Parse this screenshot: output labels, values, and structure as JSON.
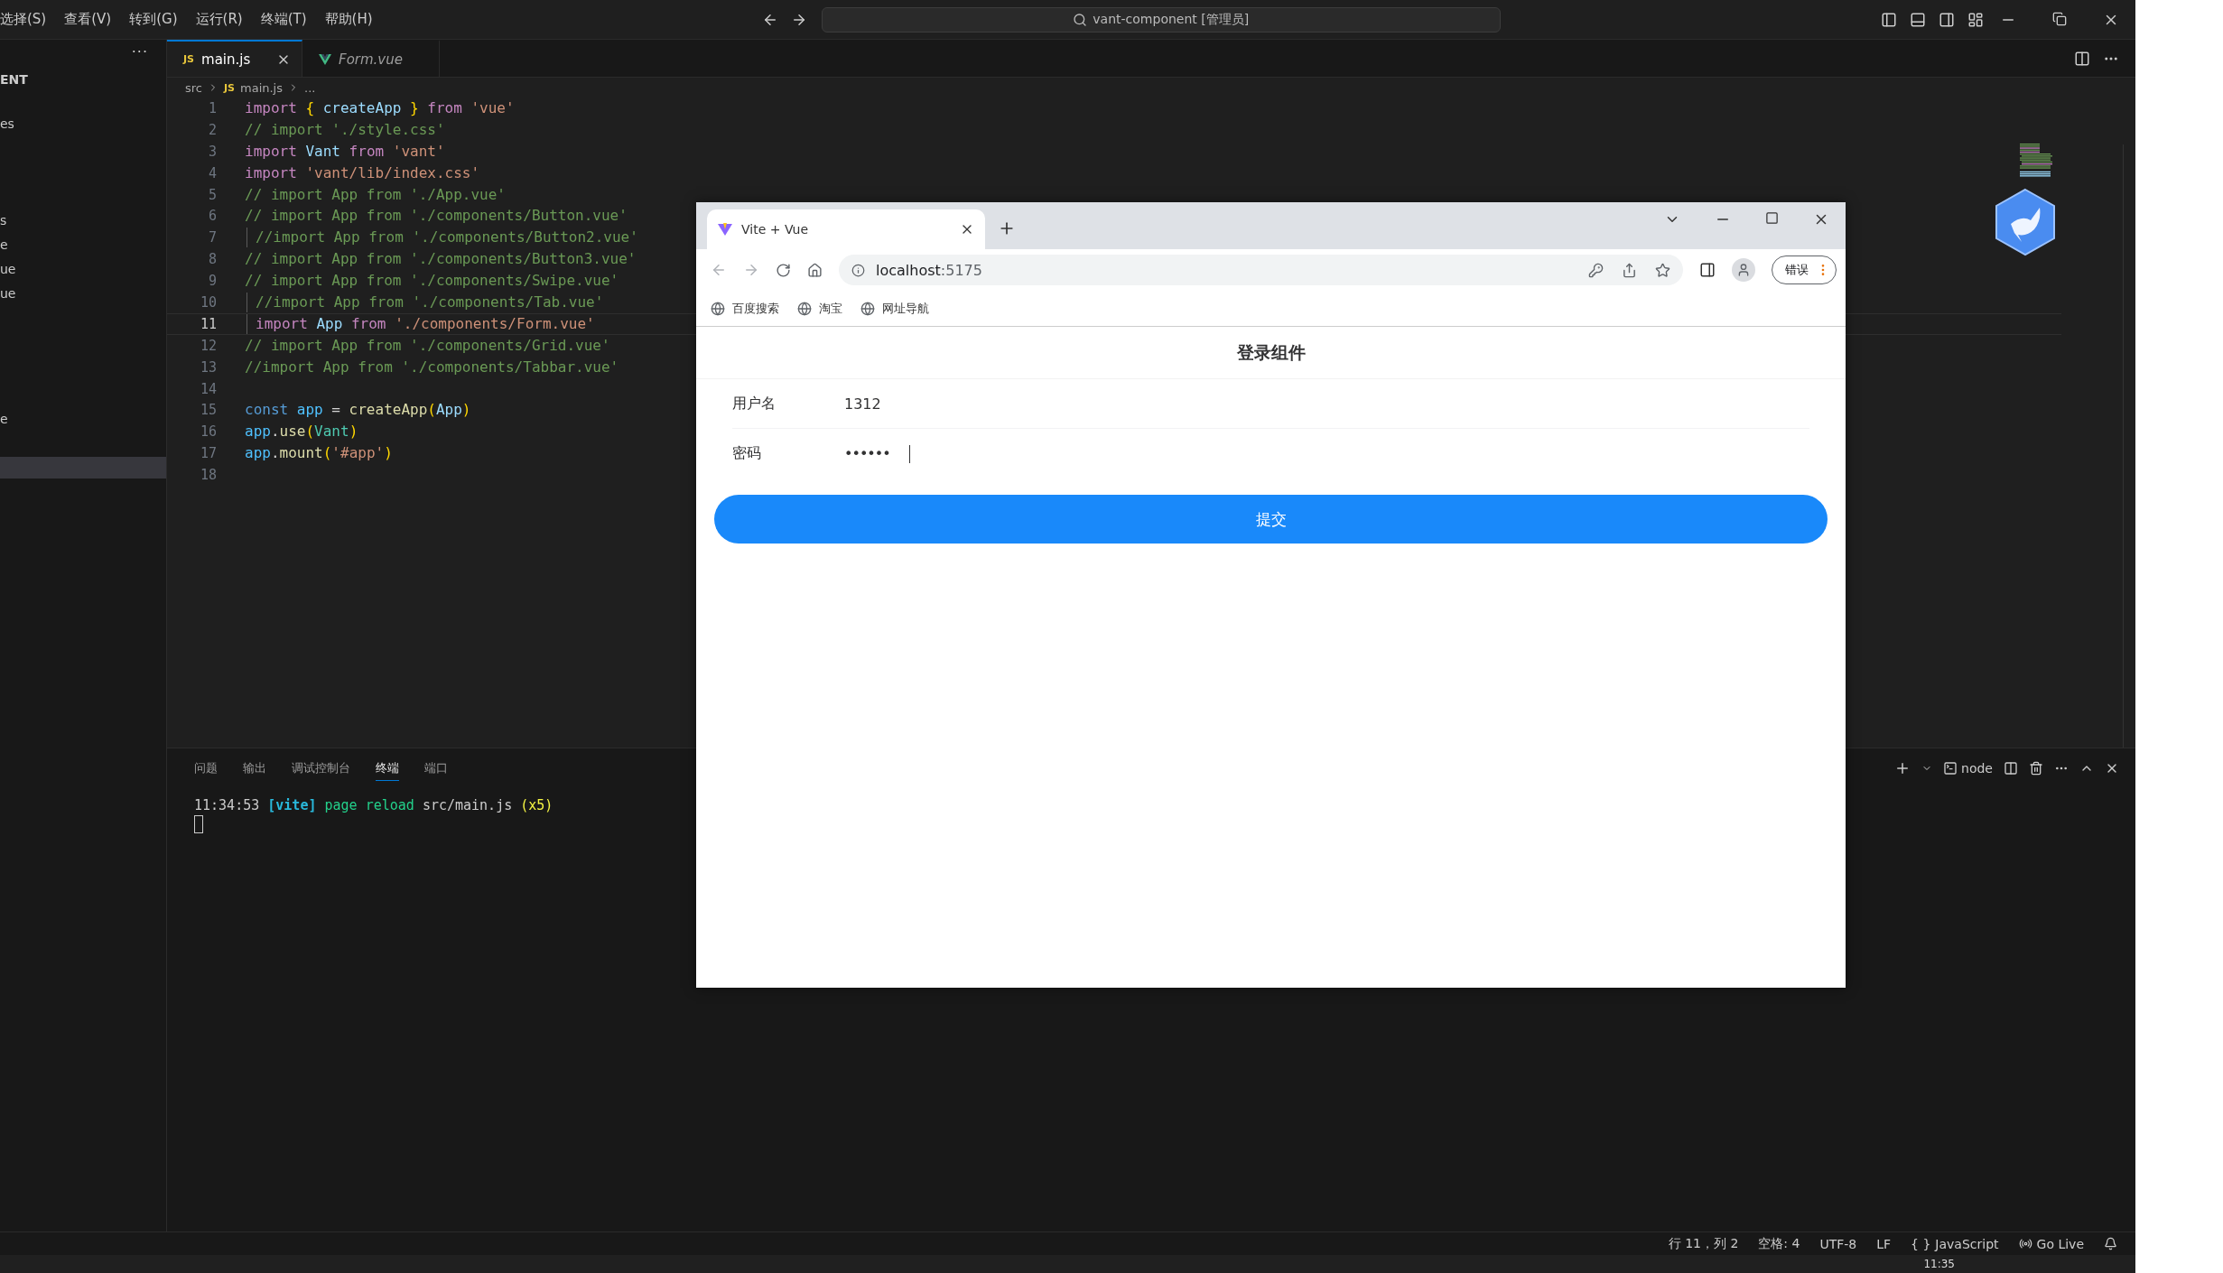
{
  "menu": [
    "选择(S)",
    "查看(V)",
    "转到(G)",
    "运行(R)",
    "终端(T)",
    "帮助(H)"
  ],
  "command_center": "vant-component [管理员]",
  "sidebar": {
    "more": "···",
    "items": [
      {
        "label": "ENT",
        "selected": false,
        "kind": "header"
      },
      {
        "label": "es",
        "selected": false,
        "kind": "item"
      },
      {
        "label": "s",
        "selected": false,
        "kind": "item"
      },
      {
        "label": "e",
        "selected": false,
        "kind": "item"
      },
      {
        "label": "ue",
        "selected": false,
        "kind": "item"
      },
      {
        "label": "ue",
        "selected": false,
        "kind": "item"
      },
      {
        "label": "e",
        "selected": false,
        "kind": "item"
      },
      {
        "selected": true,
        "kind": "spacer"
      }
    ]
  },
  "editor_tabs": [
    {
      "label": "main.js",
      "kind": "js",
      "icon_text": "JS",
      "selected": true,
      "preview": false
    },
    {
      "label": "Form.vue",
      "kind": "vue",
      "selected": false,
      "preview": true
    }
  ],
  "breadcrumb": {
    "folder": "src",
    "icon_text": "JS",
    "file": "main.js",
    "rest": "..."
  },
  "code": [
    {
      "number": "1",
      "current": false,
      "guide": false,
      "tokens": [
        {
          "text": "import ",
          "kind": "keyword"
        },
        {
          "text": "{ ",
          "kind": "brace"
        },
        {
          "text": "createApp ",
          "kind": "ident"
        },
        {
          "text": "} ",
          "kind": "brace"
        },
        {
          "text": "from ",
          "kind": "keyword"
        },
        {
          "text": "'vue'",
          "kind": "string"
        }
      ]
    },
    {
      "number": "2",
      "current": false,
      "guide": false,
      "tokens": [
        {
          "text": "// import './style.css'",
          "kind": "comment"
        }
      ]
    },
    {
      "number": "3",
      "current": false,
      "guide": false,
      "tokens": [
        {
          "text": "import ",
          "kind": "keyword"
        },
        {
          "text": "Vant ",
          "kind": "ident"
        },
        {
          "text": "from ",
          "kind": "keyword"
        },
        {
          "text": "'vant'",
          "kind": "string"
        }
      ]
    },
    {
      "number": "4",
      "current": false,
      "guide": false,
      "tokens": [
        {
          "text": "import ",
          "kind": "keyword"
        },
        {
          "text": "'vant/lib/index.css'",
          "kind": "string"
        }
      ]
    },
    {
      "number": "5",
      "current": false,
      "guide": false,
      "tokens": [
        {
          "text": "// import App from './App.vue'",
          "kind": "comment"
        }
      ]
    },
    {
      "number": "6",
      "current": false,
      "guide": false,
      "tokens": [
        {
          "text": "// import App from './components/Button.vue'",
          "kind": "comment"
        }
      ]
    },
    {
      "number": "7",
      "current": false,
      "guide": true,
      "tokens": [
        {
          "text": "//import App from './components/Button2.vue'",
          "kind": "comment"
        }
      ]
    },
    {
      "number": "8",
      "current": false,
      "guide": false,
      "tokens": [
        {
          "text": "// import App from './components/Button3.vue'",
          "kind": "comment"
        }
      ]
    },
    {
      "number": "9",
      "current": false,
      "guide": false,
      "tokens": [
        {
          "text": "// import App from './components/Swipe.vue'",
          "kind": "comment"
        }
      ]
    },
    {
      "number": "10",
      "current": false,
      "guide": true,
      "tokens": [
        {
          "text": "//import App from './components/Tab.vue'",
          "kind": "comment"
        }
      ]
    },
    {
      "number": "11",
      "current": true,
      "guide": true,
      "tokens": [
        {
          "text": "import ",
          "kind": "keyword"
        },
        {
          "text": "App ",
          "kind": "ident"
        },
        {
          "text": "from ",
          "kind": "keyword"
        },
        {
          "text": "'./components/Form.vue'",
          "kind": "string"
        }
      ]
    },
    {
      "number": "12",
      "current": false,
      "guide": false,
      "tokens": [
        {
          "text": "// import App from './components/Grid.vue'",
          "kind": "comment"
        }
      ]
    },
    {
      "number": "13",
      "current": false,
      "guide": false,
      "tokens": [
        {
          "text": "//import App from './components/Tabbar.vue'",
          "kind": "comment"
        }
      ]
    },
    {
      "number": "14",
      "current": false
    },
    {
      "number": "15",
      "current": false,
      "guide": false,
      "tokens": [
        {
          "text": "const ",
          "kind": "decl"
        },
        {
          "text": "app ",
          "kind": "var"
        },
        {
          "text": "= ",
          "kind": "plain"
        },
        {
          "text": "createApp",
          "kind": "func"
        },
        {
          "text": "(",
          "kind": "brace"
        },
        {
          "text": "App",
          "kind": "ident"
        },
        {
          "text": ")",
          "kind": "brace"
        }
      ]
    },
    {
      "number": "16",
      "current": false,
      "guide": false,
      "tokens": [
        {
          "text": "app",
          "kind": "var"
        },
        {
          "text": ".",
          "kind": "plain"
        },
        {
          "text": "use",
          "kind": "func"
        },
        {
          "text": "(",
          "kind": "brace"
        },
        {
          "text": "Vant",
          "kind": "type"
        },
        {
          "text": ")",
          "kind": "brace"
        }
      ]
    },
    {
      "number": "17",
      "current": false,
      "guide": false,
      "tokens": [
        {
          "text": "app",
          "kind": "var"
        },
        {
          "text": ".",
          "kind": "plain"
        },
        {
          "text": "mount",
          "kind": "func"
        },
        {
          "text": "(",
          "kind": "brace"
        },
        {
          "text": "'#app'",
          "kind": "string"
        },
        {
          "text": ")",
          "kind": "brace"
        }
      ]
    },
    {
      "number": "18",
      "current": false
    }
  ],
  "panel": {
    "tabs": [
      {
        "label": "问题",
        "selected": false
      },
      {
        "label": "输出",
        "selected": false
      },
      {
        "label": "调试控制台",
        "selected": false
      },
      {
        "label": "终端",
        "selected": true
      },
      {
        "label": "端口",
        "selected": false
      }
    ],
    "shell": "node",
    "terminal": [
      {
        "text": "11:34:53 ",
        "kind": "plain"
      },
      {
        "text": "[vite] ",
        "kind": "tag"
      },
      {
        "text": "page reload ",
        "kind": "ok"
      },
      {
        "text": "src/main.js ",
        "kind": "plain"
      },
      {
        "text": "(x5)",
        "kind": "count"
      }
    ]
  },
  "status_bar": {
    "position": "行 11，列 2",
    "indent": "空格: 4",
    "encoding": "UTF-8",
    "eol": "LF",
    "braces": "{ }",
    "language": "JavaScript",
    "live": "Go Live"
  },
  "taskbar": {
    "time": "11:35"
  },
  "browser": {
    "tab": {
      "title": "Vite + Vue"
    },
    "nav": {
      "back_disabled": true,
      "forward_disabled": true
    },
    "url": {
      "host": "localhost",
      "port": ":5175"
    },
    "profile_button": "错误",
    "bookmarks": [
      "百度搜索",
      "淘宝",
      "网址导航"
    ],
    "page": {
      "title": "登录组件",
      "fields": [
        {
          "label": "用户名",
          "value": "1312",
          "kind": "text"
        },
        {
          "label": "密码",
          "value": "••••••",
          "kind": "password"
        }
      ],
      "submit": "提交"
    }
  }
}
